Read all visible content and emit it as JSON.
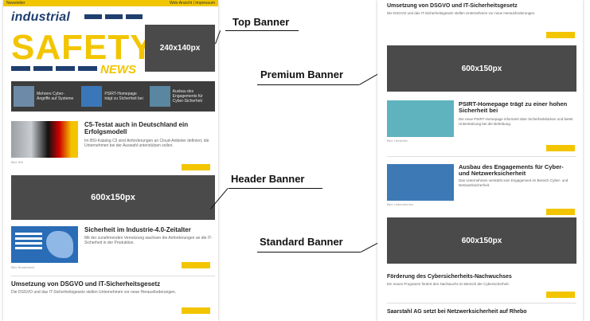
{
  "left": {
    "topstrip": {
      "left": "Newsletter",
      "right": "Web-Ansicht | Impressum"
    },
    "logo": {
      "industrial": "industrial",
      "safety": "SAFETY",
      "news": "NEWS"
    },
    "top_banner": "240x140px",
    "strip": [
      {
        "label": "Mehrere Cyber-Angriffe auf Systeme"
      },
      {
        "label": "PSIRT-Homepage trägt zu Sicherheit bei"
      },
      {
        "label": "Ausbau des Engagements für Cyber-Sicherheit"
      }
    ],
    "article1": {
      "title": "C5-Testat auch in Deutschland ein Erfolgsmodell",
      "body": "Im BSI-Katalog C5 sind Anforderungen an Cloud-Anbieter definiert, die Unternehmen bei der Auswahl unterstützen sollen.",
      "caption": "Bild: BSI"
    },
    "header_banner": "600x150px",
    "article2": {
      "title": "Sicherheit im Industrie-4.0-Zeitalter",
      "body": "Mit der zunehmenden Vernetzung wachsen die Anforderungen an die IT-Sicherheit in der Produktion.",
      "caption": "Bild: Bundesamt"
    },
    "article3": {
      "title": "Umsetzung von DSGVO und IT-Sicherheitsgesetz",
      "body": "Die DSGVO und das IT-Sicherheitsgesetz stellen Unternehmen vor neue Herausforderungen."
    }
  },
  "labels": {
    "top_banner": "Top Banner",
    "header_banner": "Header Banner",
    "premium_banner": "Premium Banner",
    "standard_banner": "Standard Banner"
  },
  "right": {
    "art0": {
      "title": "Umsetzung von DSGVO und IT-Sicherheitsgesetz",
      "body": "Die DSGVO und das IT-Sicherheitsgesetz stellen Unternehmen vor neue Herausforderungen."
    },
    "premium_banner": "600x150px",
    "art1": {
      "title": "PSIRT-Homepage trägt zu einer hohen Sicherheit bei",
      "body": "Die neue PSIRT-Homepage informiert über Sicherheitslücken und bietet Unterstützung bei der Behebung.",
      "caption": "Bild: Hersteller"
    },
    "art2": {
      "title": "Ausbau des Engagements für Cyber- und Netzwerksicherheit",
      "body": "Das Unternehmen verstärkt sein Engagement im Bereich Cyber- und Netzwerksicherheit.",
      "caption": "Bild: Unternehmen"
    },
    "standard_banner": "600x150px",
    "art3": {
      "title": "Förderung des Cybersicherheits-Nachwuchses",
      "body": "Ein neues Programm fördert den Nachwuchs im Bereich der Cybersicherheit."
    },
    "art4": {
      "title": "Saarstahl AG setzt bei Netzwerksicherheit auf Rhebo"
    }
  }
}
